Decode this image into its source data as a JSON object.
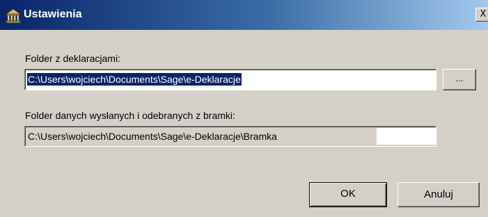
{
  "window": {
    "title": "Ustawienia",
    "close_symbol": "X"
  },
  "icons": {
    "app": "settings-app-icon",
    "close": "close-icon"
  },
  "folder_deklaracje": {
    "label": "Folder z deklaracjami:",
    "value": "C:\\Users\\wojciech\\Documents\\Sage\\e-Deklaracje",
    "browse_label": "..."
  },
  "folder_bramka": {
    "label": "Folder danych wysłanych i odebranych z bramki:",
    "value": "C:\\Users\\wojciech\\Documents\\Sage\\e-Deklaracje\\Bramka"
  },
  "buttons": {
    "ok": "OK",
    "cancel": "Anuluj"
  },
  "colors": {
    "title_bar_start": "#0a246a",
    "title_bar_end": "#a6caf0",
    "dialog_face": "#d4d0c8",
    "selection": "#0a246a"
  }
}
